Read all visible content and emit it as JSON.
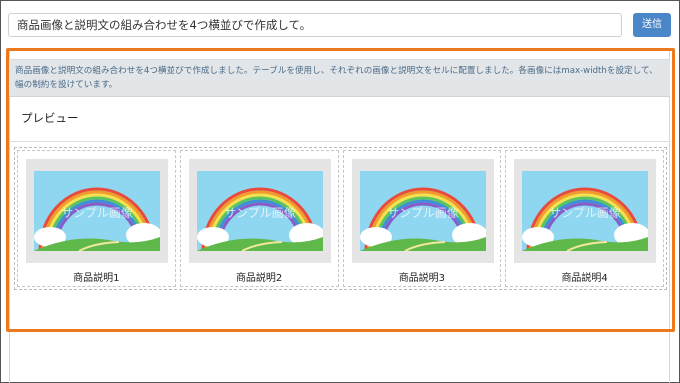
{
  "prompt": {
    "value": "商品画像と説明文の組み合わせを4つ横並びで作成して。"
  },
  "send_label": "送信",
  "description": "商品画像と説明文の組み合わせを4つ横並びで作成しました。テーブルを使用し、それぞれの画像と説明文をセルに配置しました。各画像にはmax-widthを設定して、幅の制約を設けています。",
  "preview_title": "プレビュー",
  "image_watermark": "サンプル画像",
  "products": [
    {
      "caption": "商品説明1"
    },
    {
      "caption": "商品説明2"
    },
    {
      "caption": "商品説明3"
    },
    {
      "caption": "商品説明4"
    }
  ],
  "colors": {
    "accent": "#ec7a1c",
    "button": "#4a86c8",
    "description_text": "#4a6a86"
  }
}
